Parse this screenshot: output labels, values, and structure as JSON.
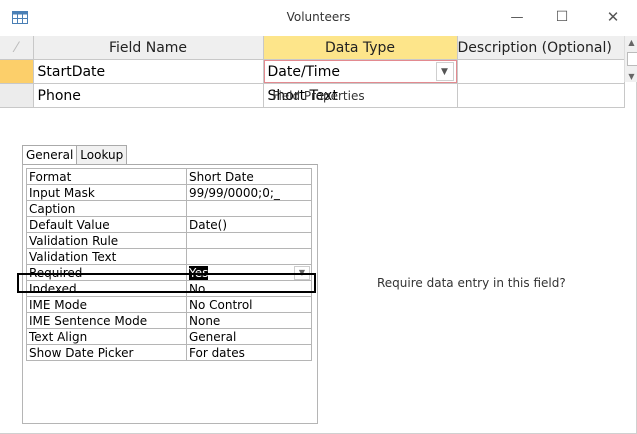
{
  "window": {
    "title": "Volunteers",
    "controls": [
      "—",
      "☐",
      "✕"
    ]
  },
  "grid": {
    "headers": [
      "Field Name",
      "Data Type",
      "Description (Optional)"
    ],
    "rows": [
      {
        "field": "StartDate",
        "type": "Date/Time",
        "description": ""
      },
      {
        "field": "Phone",
        "type": "Short Text",
        "description": ""
      }
    ]
  },
  "field_properties": {
    "label": "Field Properties",
    "tabs": [
      "General",
      "Lookup"
    ],
    "rows": [
      {
        "name": "Format",
        "value": "Short Date"
      },
      {
        "name": "Input Mask",
        "value": "99/99/0000;0;_"
      },
      {
        "name": "Caption",
        "value": ""
      },
      {
        "name": "Default Value",
        "value": "Date()"
      },
      {
        "name": "Validation Rule",
        "value": ""
      },
      {
        "name": "Validation Text",
        "value": ""
      },
      {
        "name": "Required",
        "value": "Yes"
      },
      {
        "name": "Indexed",
        "value": "No"
      },
      {
        "name": "IME Mode",
        "value": "No Control"
      },
      {
        "name": "IME Sentence Mode",
        "value": "None"
      },
      {
        "name": "Text Align",
        "value": "General"
      },
      {
        "name": "Show Date Picker",
        "value": "For dates"
      }
    ],
    "help_text": "Require data entry in this field?"
  },
  "colors": {
    "selected_header": "#fde58a",
    "active_row_selector": "#fccf6a",
    "data_type_border": "#e38a90"
  }
}
